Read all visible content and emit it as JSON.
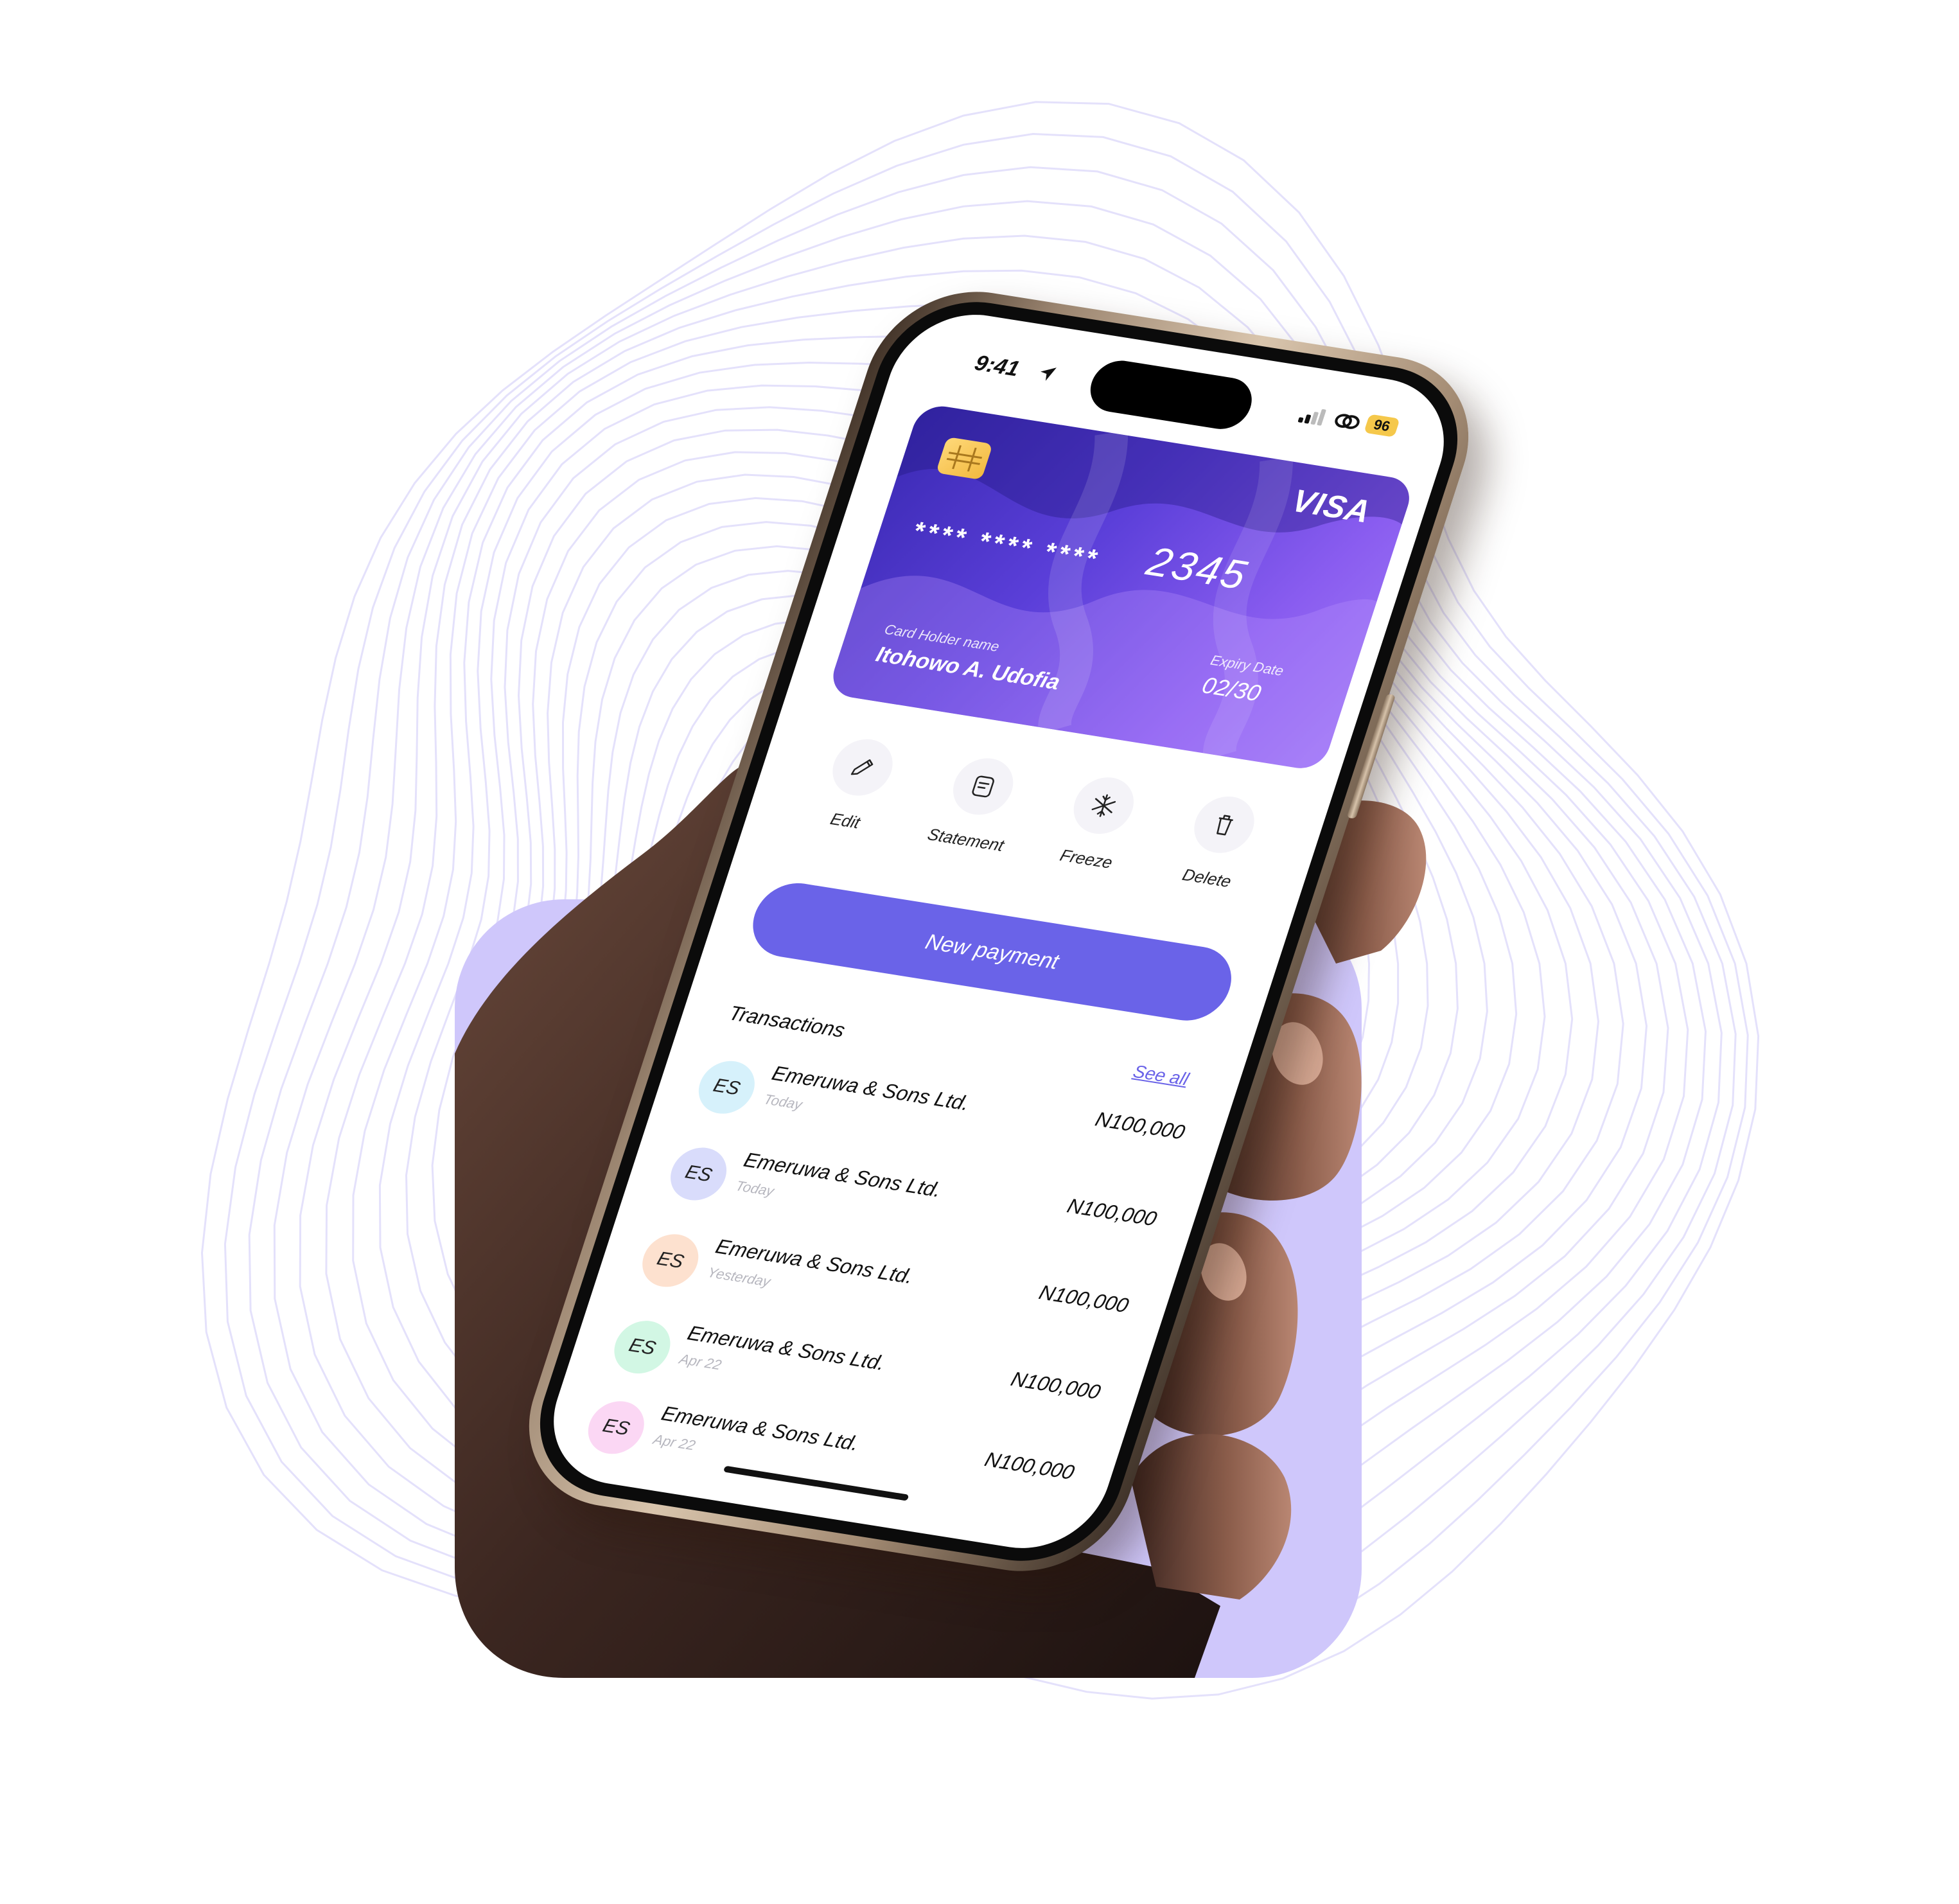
{
  "status_bar": {
    "time": "9:41",
    "battery": "96",
    "icons": [
      "location-arrow-icon",
      "signal-icon",
      "link-icon"
    ]
  },
  "card": {
    "brand": "VISA",
    "masked_number": "**** **** ****",
    "last4": "2345",
    "holder_label": "Card Holder name",
    "holder_name": "Itohowo A. Udofia",
    "expiry_label": "Expiry Date",
    "expiry_value": "02/30",
    "colors": {
      "start": "#3b2ab4",
      "end": "#9f78f5",
      "chip": "#f2b93e"
    }
  },
  "actions": [
    {
      "label": "Edit",
      "icon": "pencil-icon"
    },
    {
      "label": "Statement",
      "icon": "document-icon"
    },
    {
      "label": "Freeze",
      "icon": "snowflake-icon"
    },
    {
      "label": "Delete",
      "icon": "trash-icon"
    }
  ],
  "new_payment_label": "New payment",
  "transactions": {
    "title": "Transactions",
    "see_all": "See all",
    "items": [
      {
        "initials": "ES",
        "name": "Emeruwa & Sons Ltd.",
        "date": "Today",
        "amount": "N100,000",
        "color": "#d6f1fb"
      },
      {
        "initials": "ES",
        "name": "Emeruwa & Sons Ltd.",
        "date": "Today",
        "amount": "N100,000",
        "color": "#d9dcfb"
      },
      {
        "initials": "ES",
        "name": "Emeruwa & Sons Ltd.",
        "date": "Yesterday",
        "amount": "N100,000",
        "color": "#fde1cf"
      },
      {
        "initials": "ES",
        "name": "Emeruwa & Sons Ltd.",
        "date": "Apr 22",
        "amount": "N100,000",
        "color": "#d2f7e4"
      },
      {
        "initials": "ES",
        "name": "Emeruwa & Sons Ltd.",
        "date": "Apr 22",
        "amount": "N100,000",
        "color": "#fbd7f4"
      }
    ]
  },
  "theme": {
    "accent": "#6a63e8",
    "panel": "#cfc7fb",
    "lines": "#e4e1fb"
  }
}
